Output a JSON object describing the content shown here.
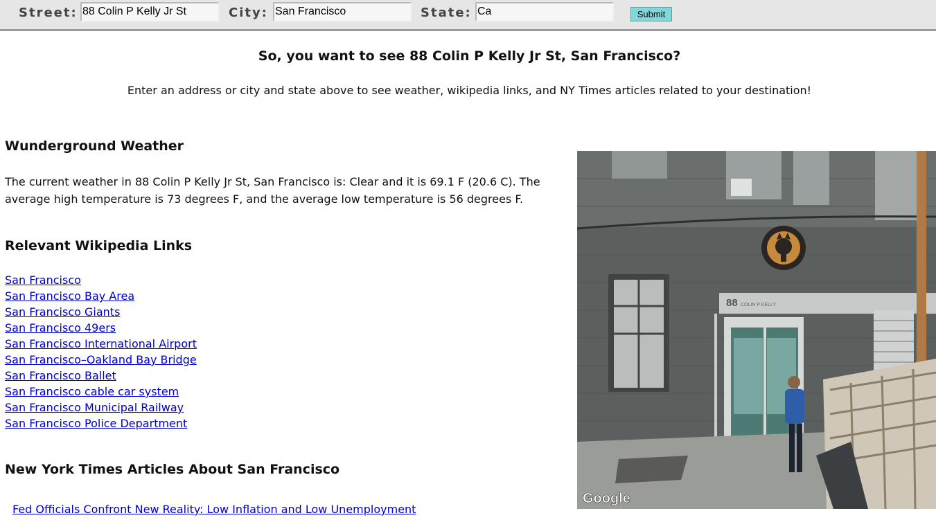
{
  "search": {
    "street_label": "Street:",
    "street_value": "88 Colin P Kelly Jr St",
    "city_label": "City:",
    "city_value": "San Francisco",
    "state_label": "State:",
    "state_value": "Ca",
    "submit_label": "Submit"
  },
  "header": {
    "headline": "So, you want to see 88 Colin P Kelly Jr St, San Francisco?",
    "intro": "Enter an address or city and state above to see weather, wikipedia links, and NY Times articles related to your destination!"
  },
  "weather": {
    "heading": "Wunderground Weather",
    "text": "The current weather in 88 Colin P Kelly Jr St, San Francisco is: Clear and it is 69.1 F (20.6 C). The average high temperature is 73 degrees F, and the average low temperature is 56 degrees F."
  },
  "wikipedia": {
    "heading": "Relevant Wikipedia Links",
    "links": [
      "San Francisco",
      "San Francisco Bay Area",
      "San Francisco Giants",
      "San Francisco 49ers",
      "San Francisco International Airport",
      "San Francisco–Oakland Bay Bridge",
      "San Francisco Ballet",
      "San Francisco cable car system",
      "San Francisco Municipal Railway",
      "San Francisco Police Department"
    ]
  },
  "nyt": {
    "heading": "New York Times Articles About San Francisco",
    "articles": [
      "Fed Officials Confront New Reality: Low Inflation and Low Unemployment"
    ]
  },
  "streetview": {
    "address_sign": "88",
    "address_sign_small": "COLIN P KELLY",
    "watermark": "Google"
  }
}
